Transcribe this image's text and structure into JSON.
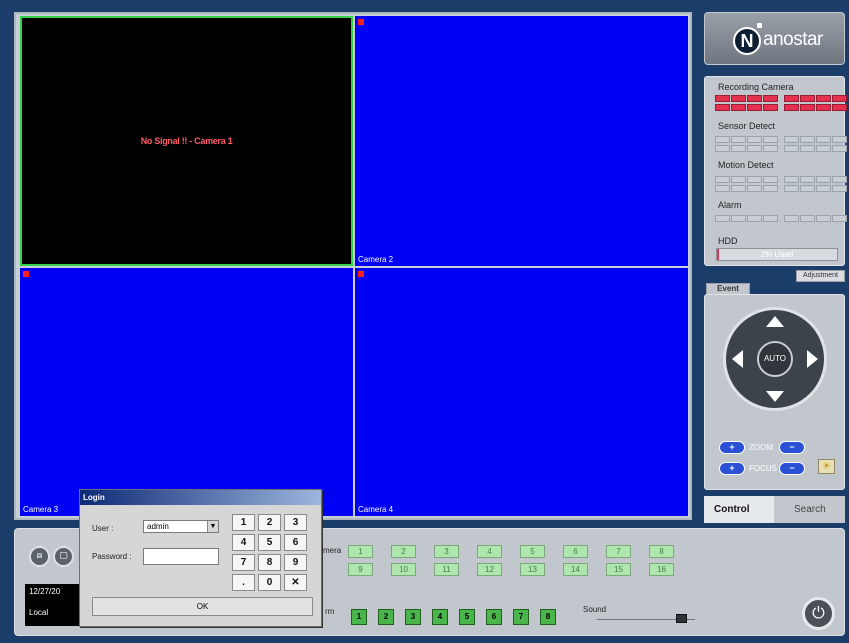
{
  "cameras": [
    {
      "label": "",
      "status": "No Signal !! - Camera 1"
    },
    {
      "label": "Camera 2"
    },
    {
      "label": "Camera 3"
    },
    {
      "label": "Camera 4"
    }
  ],
  "logo": {
    "text": "anostar",
    "initial": "N"
  },
  "status_panel": {
    "recording_camera": "Recording Camera",
    "sensor_detect": "Sensor Detect",
    "motion_detect": "Motion Detect",
    "alarm": "Alarm",
    "hdd": "HDD",
    "hdd_used_text": "2% Used",
    "hdd_used_fraction": 0.02
  },
  "tabs": {
    "adjustment": "Adjustment",
    "event": "Event",
    "control": "Control",
    "search": "Search"
  },
  "ptz": {
    "auto": "AUTO",
    "zoom": "ZOOM",
    "focus": "FOCUS",
    "plus": "+",
    "minus": "−"
  },
  "bottom": {
    "date": "12/27/20",
    "local": "Local",
    "camera_label": "mera",
    "alarm_label": "rm",
    "sound_label": "Sound",
    "camera_buttons_row1": [
      "1",
      "2",
      "3",
      "4",
      "5",
      "6",
      "7",
      "8"
    ],
    "camera_buttons_row2": [
      "9",
      "10",
      "11",
      "12",
      "13",
      "14",
      "15",
      "16"
    ],
    "alarm_buttons": [
      "1",
      "2",
      "3",
      "4",
      "5",
      "6",
      "7",
      "8"
    ],
    "sound_level": 0.87
  },
  "login": {
    "title": "Login",
    "user_label": "User :",
    "user_value": "admin",
    "password_label": "Password :",
    "keys": [
      "1",
      "2",
      "3",
      "4",
      "5",
      "6",
      "7",
      "8",
      "9",
      ".",
      "0",
      "✕"
    ],
    "ok": "OK"
  },
  "colors": {
    "video_blue": "#0000f5",
    "rec_red": "#ff1d1d",
    "active_border": "#35d14b",
    "background": "#1b3d6a"
  }
}
